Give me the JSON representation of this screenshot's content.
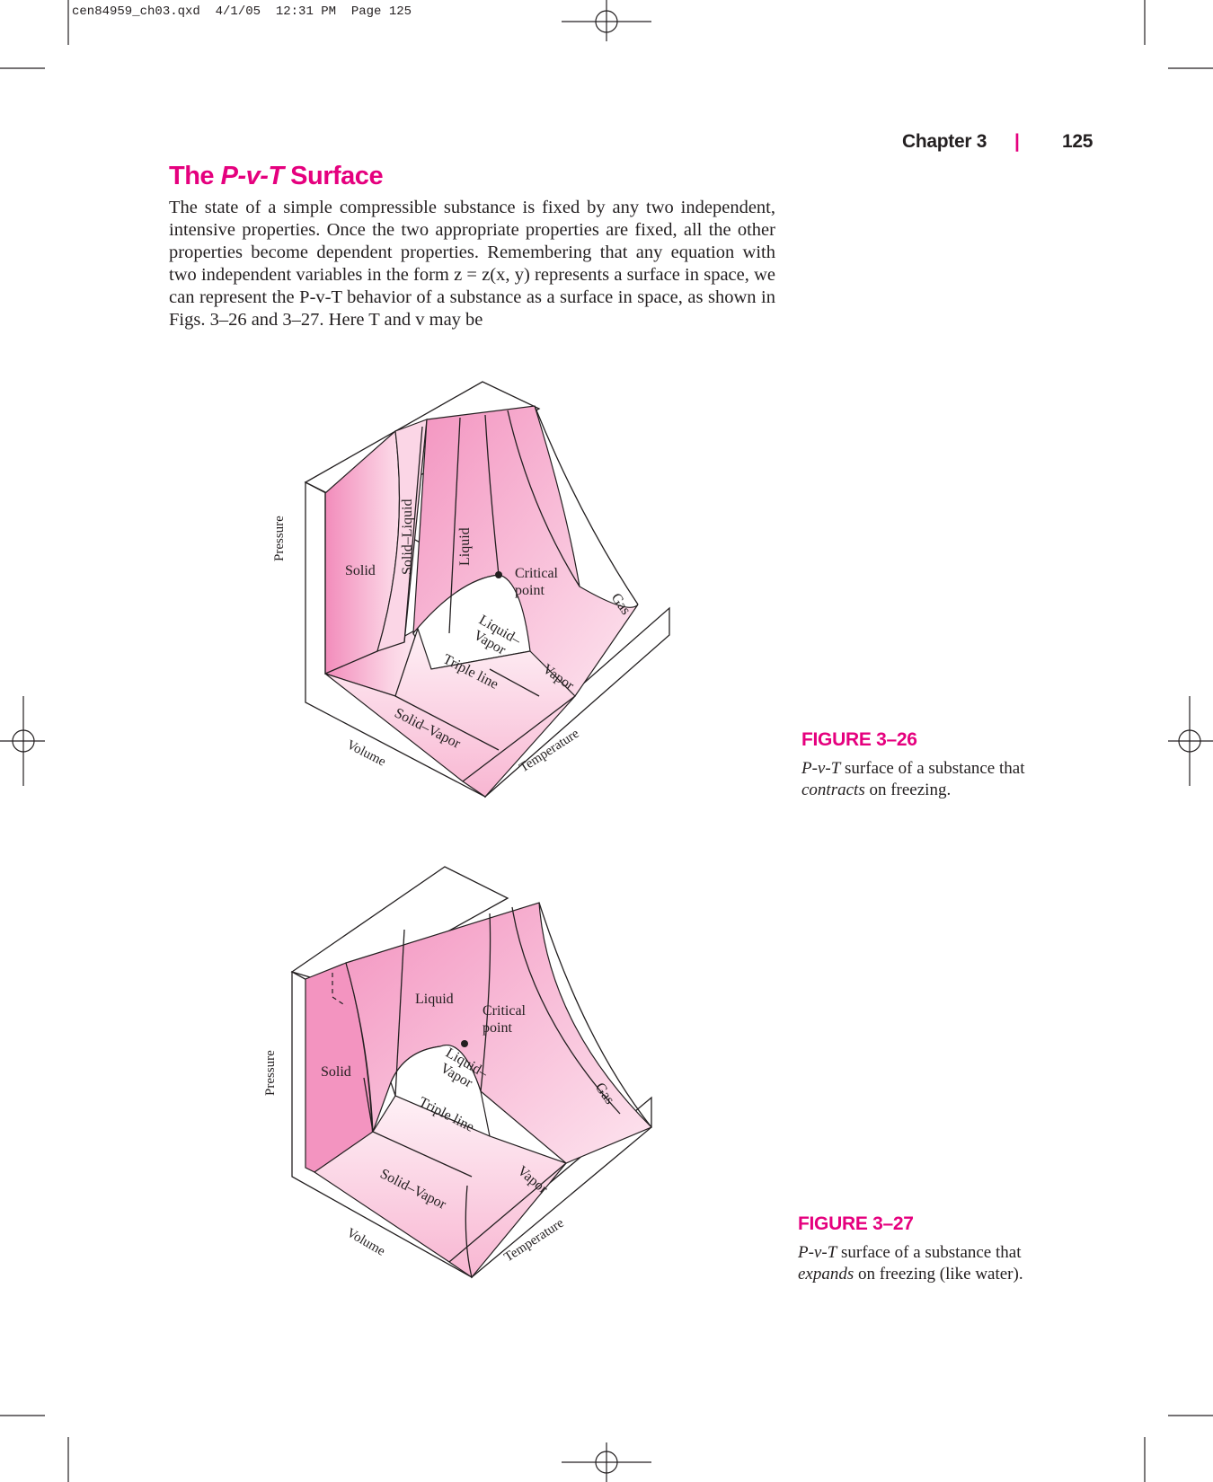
{
  "slug": "cen84959_ch03.qxd  4/1/05  12:31 PM  Page 125",
  "header": {
    "chapter": "Chapter 3",
    "separator": "|",
    "page_number": "125"
  },
  "section": {
    "title_prefix": "The ",
    "title_italic": "P-v-T",
    "title_suffix": " Surface"
  },
  "body_paragraph": "The state of a simple compressible substance is fixed by any two independent, intensive properties. Once the two appropriate properties are fixed, all the other properties become dependent properties. Remembering that any equation with two independent variables in the form z = z(x, y) represents a surface in space, we can represent the P-v-T behavior of a substance as a surface in space, as shown in Figs. 3–26 and 3–27. Here T and v may be",
  "figure1": {
    "label": "FIGURE 3–26",
    "caption_italic1": "P-v-T",
    "caption_text1": " surface of a substance that ",
    "caption_italic2": "contracts",
    "caption_text2": " on freezing.",
    "regions": {
      "solid": "Solid",
      "solid_liquid": "Solid–Liquid",
      "liquid": "Liquid",
      "critical_point_1": "Critical",
      "critical_point_2": "point",
      "liquid_vapor_1": "Liquid–",
      "liquid_vapor_2": "Vapor",
      "triple_line": "Triple line",
      "vapor": "Vapor",
      "gas": "Gas",
      "solid_vapor": "Solid–Vapor"
    },
    "axes": {
      "pressure": "Pressure",
      "volume": "Volume",
      "temperature": "Temperature"
    }
  },
  "figure2": {
    "label": "FIGURE 3–27",
    "caption_italic1": "P-v-T",
    "caption_text1": " surface of a substance that ",
    "caption_italic2": "expands",
    "caption_text2": " on freezing (like water).",
    "regions": {
      "solid": "Solid",
      "liquid": "Liquid",
      "critical_point_1": "Critical",
      "critical_point_2": "point",
      "liquid_vapor_1": "Liquid–",
      "liquid_vapor_2": "Vapor",
      "triple_line": "Triple line",
      "vapor": "Vapor",
      "gas": "Gas",
      "solid_vapor": "Solid–Vapor"
    },
    "axes": {
      "pressure": "Pressure",
      "volume": "Volume",
      "temperature": "Temperature"
    }
  },
  "colors": {
    "accent": "#e5007e",
    "surface": "#f394c0",
    "surface_light": "#fde3ee"
  }
}
